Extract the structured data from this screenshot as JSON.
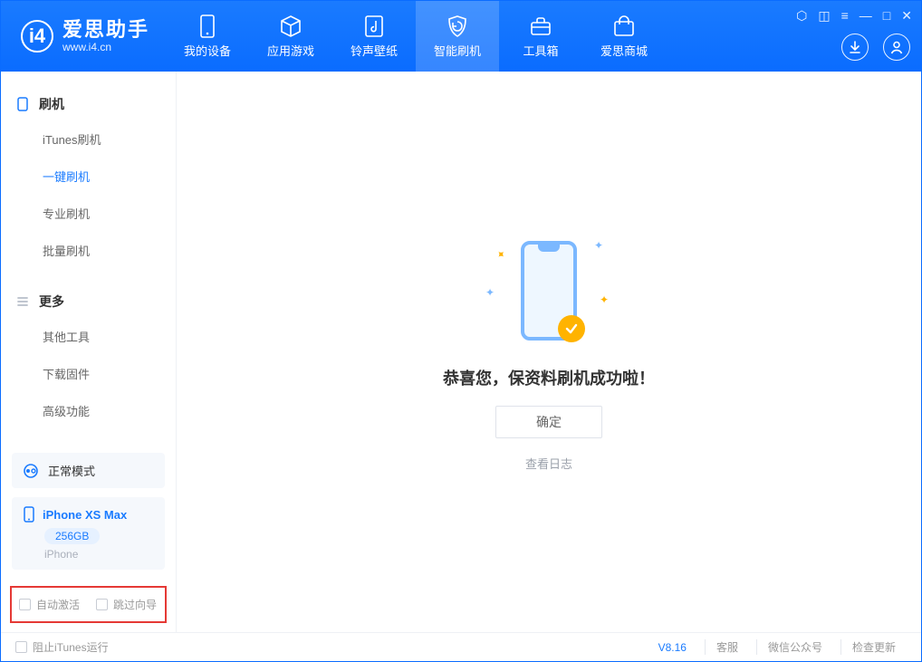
{
  "app": {
    "title": "爱思助手",
    "subtitle": "www.i4.cn"
  },
  "window_controls": {
    "feedback": "⬡",
    "skin": "◫",
    "menu": "≡",
    "min": "—",
    "max": "□",
    "close": "✕"
  },
  "tabs": [
    {
      "label": "我的设备",
      "icon": "device"
    },
    {
      "label": "应用游戏",
      "icon": "cube"
    },
    {
      "label": "铃声壁纸",
      "icon": "music"
    },
    {
      "label": "智能刷机",
      "icon": "shield",
      "active": true
    },
    {
      "label": "工具箱",
      "icon": "toolbox"
    },
    {
      "label": "爱思商城",
      "icon": "store"
    }
  ],
  "header_right": {
    "download": "↓",
    "user": "◯"
  },
  "sidebar": {
    "group1": {
      "title": "刷机",
      "items": [
        {
          "label": "iTunes刷机"
        },
        {
          "label": "一键刷机",
          "active": true
        },
        {
          "label": "专业刷机"
        },
        {
          "label": "批量刷机"
        }
      ]
    },
    "group2": {
      "title": "更多",
      "items": [
        {
          "label": "其他工具"
        },
        {
          "label": "下载固件"
        },
        {
          "label": "高级功能"
        }
      ]
    }
  },
  "device": {
    "mode_label": "正常模式",
    "name": "iPhone XS Max",
    "capacity": "256GB",
    "type": "iPhone"
  },
  "redbox": {
    "auto_activate": "自动激活",
    "skip_guide": "跳过向导"
  },
  "main": {
    "success_msg": "恭喜您，保资料刷机成功啦！",
    "ok_button": "确定",
    "view_log": "查看日志"
  },
  "footer": {
    "block_itunes": "阻止iTunes运行",
    "version": "V8.16",
    "support": "客服",
    "wechat": "微信公众号",
    "check_update": "检查更新"
  }
}
